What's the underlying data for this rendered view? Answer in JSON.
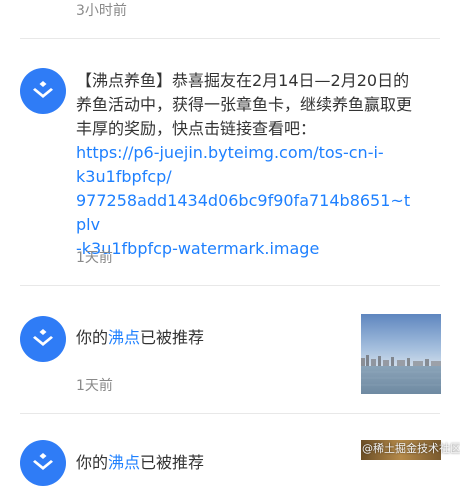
{
  "messages": [
    {
      "time": "3小时前"
    },
    {
      "text_prefix": "【沸点养鱼】恭喜掘友在2月14日—2月20日的养鱼活动中，获得一张章鱼卡，继续养鱼赢取更丰厚的奖励，快点击链接查看吧：",
      "link_lines": [
        "https://p6-juejin.byteimg.com/tos-cn-i-",
        "k3u1fbpfcp/",
        "977258add1434d06bc9f90fa714b8651~tplv",
        "-k3u1fbpfcp-watermark.image"
      ],
      "time": "1天前"
    },
    {
      "text_before": "你的",
      "highlight": "沸点",
      "text_after": "已被推荐",
      "time": "1天前"
    },
    {
      "text_before": "你的",
      "highlight": "沸点",
      "text_after": "已被推荐",
      "watermark": "@稀土掘金技术社区"
    }
  ],
  "colors": {
    "avatar": "#2f7cf6",
    "link": "#1e80ff",
    "time": "#8a8a8a"
  },
  "icons": {
    "avatar_logo": "juejin-logo-icon"
  }
}
